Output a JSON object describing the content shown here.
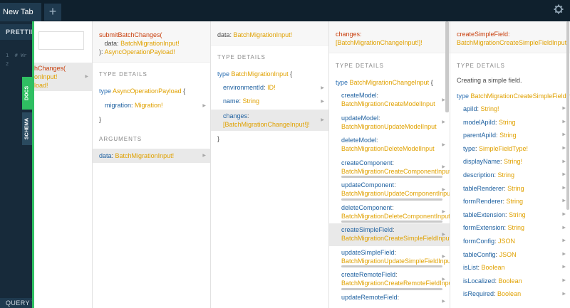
{
  "tabs": [
    {
      "label": "New Tab"
    }
  ],
  "tab_add": "+",
  "editor": {
    "prettify": "PRETTIFY",
    "gutter": "1  # Wr\n2",
    "query_vars": "QUERY VA"
  },
  "side_tabs": {
    "docs": "DOCS",
    "schema": "SCHEMA"
  },
  "col_a": {
    "row_line1": "hChanges(",
    "row_line2": "onInput!",
    "row_line3": "load!"
  },
  "col_b": {
    "header": {
      "name": "submitBatchChanges(",
      "arg_name": "data",
      "arg_type": "BatchMigrationInput!",
      "close": "): ",
      "return_type": "AsyncOperationPayload!"
    },
    "type_details": "TYPE DETAILS",
    "type_kw": "type",
    "type_name": "AsyncOperationPayload",
    "type_brace_open": "{",
    "fields": [
      {
        "name": "migration",
        "type": "Migration!"
      }
    ],
    "type_brace_close": "}",
    "arguments": "ARGUMENTS",
    "args": [
      {
        "name": "data",
        "type": "BatchMigrationInput!"
      }
    ]
  },
  "col_c": {
    "header": {
      "name": "data",
      "type": "BatchMigrationInput!"
    },
    "type_details": "TYPE DETAILS",
    "type_kw": "type",
    "type_name": "BatchMigrationInput",
    "type_brace_open": "{",
    "fields": [
      {
        "name": "environmentId",
        "type": "ID!"
      },
      {
        "name": "name",
        "type": "String"
      },
      {
        "name": "changes",
        "type": "[BatchMigrationChangeInput!]!"
      }
    ],
    "type_brace_close": "}"
  },
  "col_d": {
    "header": {
      "name": "changes",
      "type": "[BatchMigrationChangeInput!]!"
    },
    "type_details": "TYPE DETAILS",
    "type_kw": "type",
    "type_name": "BatchMigrationChangeInput",
    "type_brace_open": "{",
    "fields": [
      {
        "name": "createModel",
        "type": "BatchMigrationCreateModelInput"
      },
      {
        "name": "updateModel",
        "type": "BatchMigrationUpdateModelInput"
      },
      {
        "name": "deleteModel",
        "type": "BatchMigrationDeleteModelInput"
      },
      {
        "name": "createComponent",
        "type": "BatchMigrationCreateComponentInput"
      },
      {
        "name": "updateComponent",
        "type": "BatchMigrationUpdateComponentInput"
      },
      {
        "name": "deleteComponent",
        "type": "BatchMigrationDeleteComponentInput"
      },
      {
        "name": "createSimpleField",
        "type": "BatchMigrationCreateSimpleFieldInput"
      },
      {
        "name": "updateSimpleField",
        "type": "BatchMigrationUpdateSimpleFieldInput"
      },
      {
        "name": "createRemoteField",
        "type": "BatchMigrationCreateRemoteFieldInput"
      },
      {
        "name": "updateRemoteField",
        "type": ""
      }
    ]
  },
  "col_e": {
    "header": {
      "name": "createSimpleField",
      "type": "BatchMigrationCreateSimpleFieldInput"
    },
    "type_details": "TYPE DETAILS",
    "description": "Creating a simple field.",
    "type_kw": "type",
    "type_name": "BatchMigrationCreateSimpleFieldInp",
    "fields": [
      {
        "name": "apiId",
        "type": "String!"
      },
      {
        "name": "modelApiId",
        "type": "String"
      },
      {
        "name": "parentApiId",
        "type": "String"
      },
      {
        "name": "type",
        "type": "SimpleFieldType!"
      },
      {
        "name": "displayName",
        "type": "String!"
      },
      {
        "name": "description",
        "type": "String"
      },
      {
        "name": "tableRenderer",
        "type": "String"
      },
      {
        "name": "formRenderer",
        "type": "String"
      },
      {
        "name": "tableExtension",
        "type": "String"
      },
      {
        "name": "formExtension",
        "type": "String"
      },
      {
        "name": "formConfig",
        "type": "JSON"
      },
      {
        "name": "tableConfig",
        "type": "JSON"
      },
      {
        "name": "isList",
        "type": "Boolean"
      },
      {
        "name": "isLocalized",
        "type": "Boolean"
      },
      {
        "name": "isRequired",
        "type": "Boolean"
      }
    ]
  },
  "colors": {
    "accent": "#2fbf62",
    "field_name": "#c9410f",
    "type_name": "#e0a100",
    "keyword": "#2d70b3"
  }
}
